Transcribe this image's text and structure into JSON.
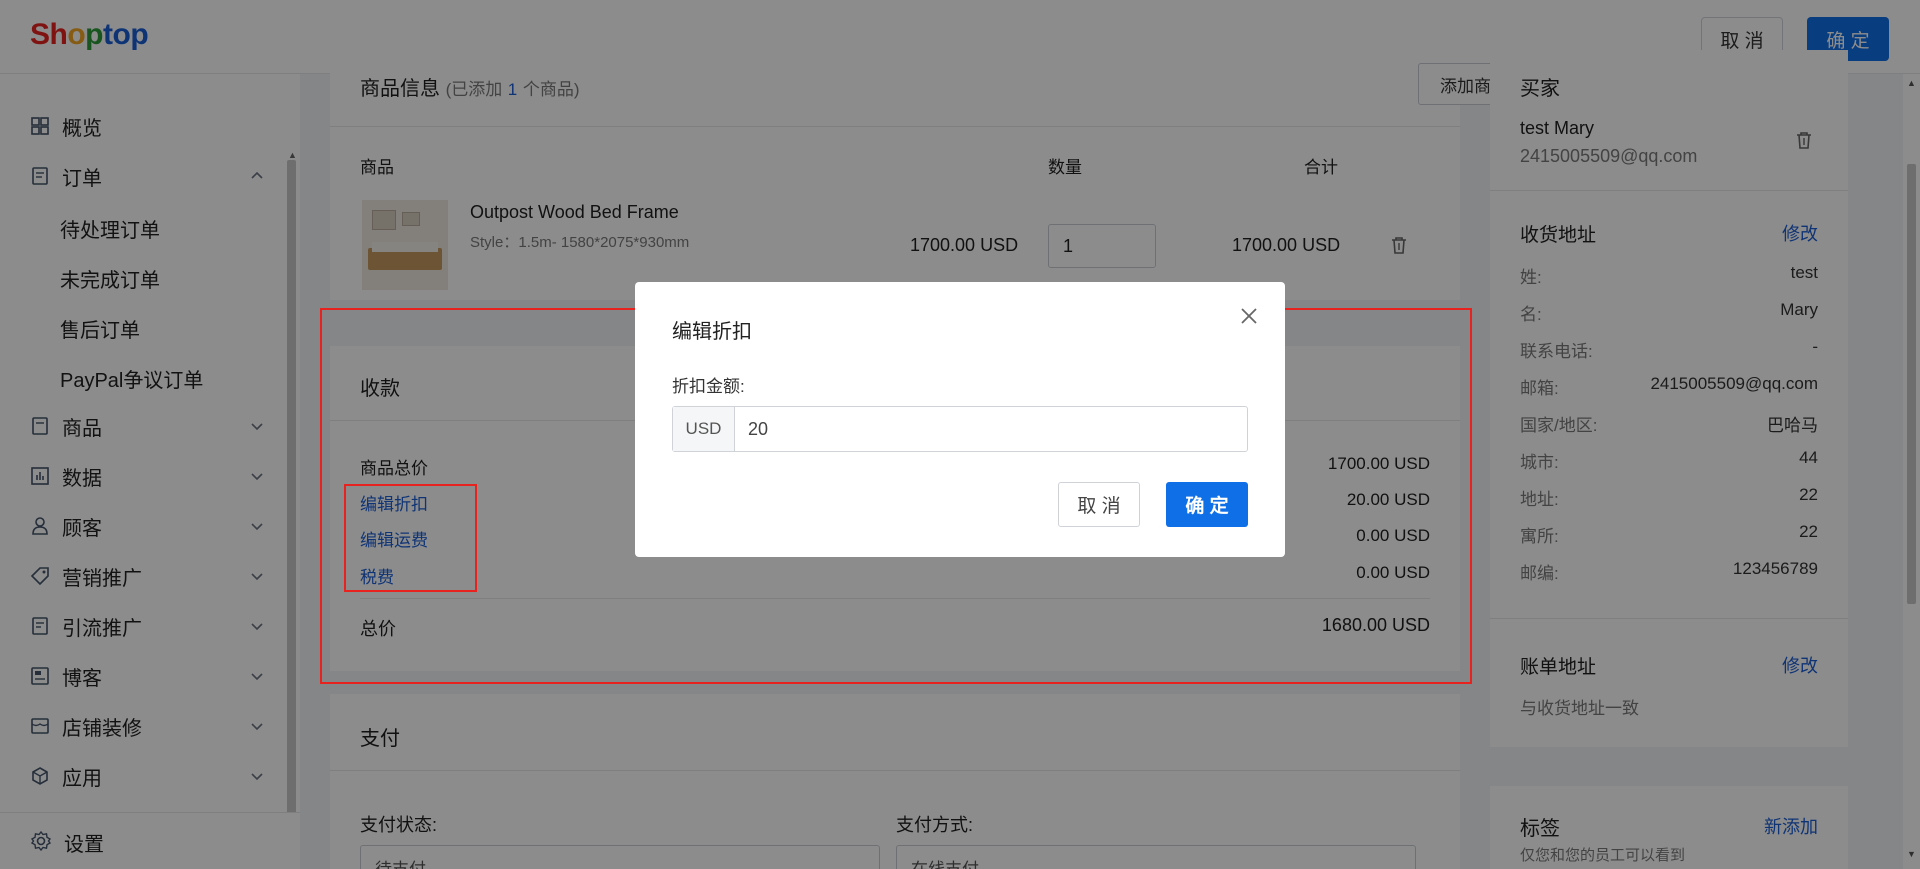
{
  "header": {
    "logo_letters": [
      "S",
      "h",
      "o",
      "p",
      "t",
      "o",
      "p"
    ],
    "logo_colors": [
      "#e8231f",
      "#e8231f",
      "#f5a623",
      "#2e9b3a",
      "#1d5fd6",
      "#1d5fd6",
      "#1d5fd6"
    ],
    "cancel_label": "取 消",
    "ok_label": "确 定"
  },
  "sidebar": {
    "items": [
      {
        "label": "概览",
        "icon": "dashboard-icon"
      },
      {
        "label": "订单",
        "icon": "order-icon",
        "expanded": true
      },
      {
        "label": "商品",
        "icon": "product-icon"
      },
      {
        "label": "数据",
        "icon": "chart-icon"
      },
      {
        "label": "顾客",
        "icon": "user-icon"
      },
      {
        "label": "营销推广",
        "icon": "tag-icon"
      },
      {
        "label": "引流推广",
        "icon": "traffic-icon"
      },
      {
        "label": "博客",
        "icon": "blog-icon"
      },
      {
        "label": "店铺装修",
        "icon": "store-icon"
      },
      {
        "label": "应用",
        "icon": "app-icon"
      }
    ],
    "order_sub": [
      "待处理订单",
      "未完成订单",
      "售后订单",
      "PayPal争议订单"
    ],
    "settings_label": "设置"
  },
  "products": {
    "title": "商品信息",
    "count_prefix": "(已添加",
    "count": "1",
    "count_suffix": "个商品)",
    "add_button": "添加商品",
    "col_product": "商品",
    "col_qty": "数量",
    "col_total": "合计",
    "item": {
      "name": "Outpost Wood Bed Frame",
      "style": "Style：1.5m- 1580*2075*930mm",
      "price": "1700.00 USD",
      "qty": "1",
      "total": "1700.00 USD"
    }
  },
  "payment_summary": {
    "title": "收款",
    "subtotal_label": "商品总价",
    "subtotal": "1700.00 USD",
    "discount_label": "编辑折扣",
    "discount": "20.00 USD",
    "shipping_label": "编辑运费",
    "shipping": "0.00 USD",
    "tax_label": "税费",
    "tax": "0.00 USD",
    "total_label": "总价",
    "total": "1680.00 USD"
  },
  "pay": {
    "title": "支付",
    "status_label": "支付状态:",
    "status_value": "待支付",
    "method_label": "支付方式:",
    "method_value": "在线支付"
  },
  "buyer": {
    "title": "买家",
    "name": "test Mary",
    "email": "2415005509@qq.com"
  },
  "shipping_address": {
    "title": "收货地址",
    "edit": "修改",
    "rows": [
      {
        "label": "姓:",
        "value": "test"
      },
      {
        "label": "名:",
        "value": "Mary"
      },
      {
        "label": "联系电话:",
        "value": "-"
      },
      {
        "label": "邮箱:",
        "value": "2415005509@qq.com"
      },
      {
        "label": "国家/地区:",
        "value": "巴哈马"
      },
      {
        "label": "城市:",
        "value": "44"
      },
      {
        "label": "地址:",
        "value": "22"
      },
      {
        "label": "寓所:",
        "value": "22"
      },
      {
        "label": "邮编:",
        "value": "123456789"
      }
    ]
  },
  "billing": {
    "title": "账单地址",
    "edit": "修改",
    "text": "与收货地址一致"
  },
  "tags": {
    "title": "标签",
    "add": "新添加",
    "hint": "仅您和您的员工可以看到"
  },
  "modal": {
    "title": "编辑折扣",
    "label": "折扣金额:",
    "currency": "USD",
    "value": "20",
    "cancel": "取 消",
    "ok": "确 定"
  }
}
